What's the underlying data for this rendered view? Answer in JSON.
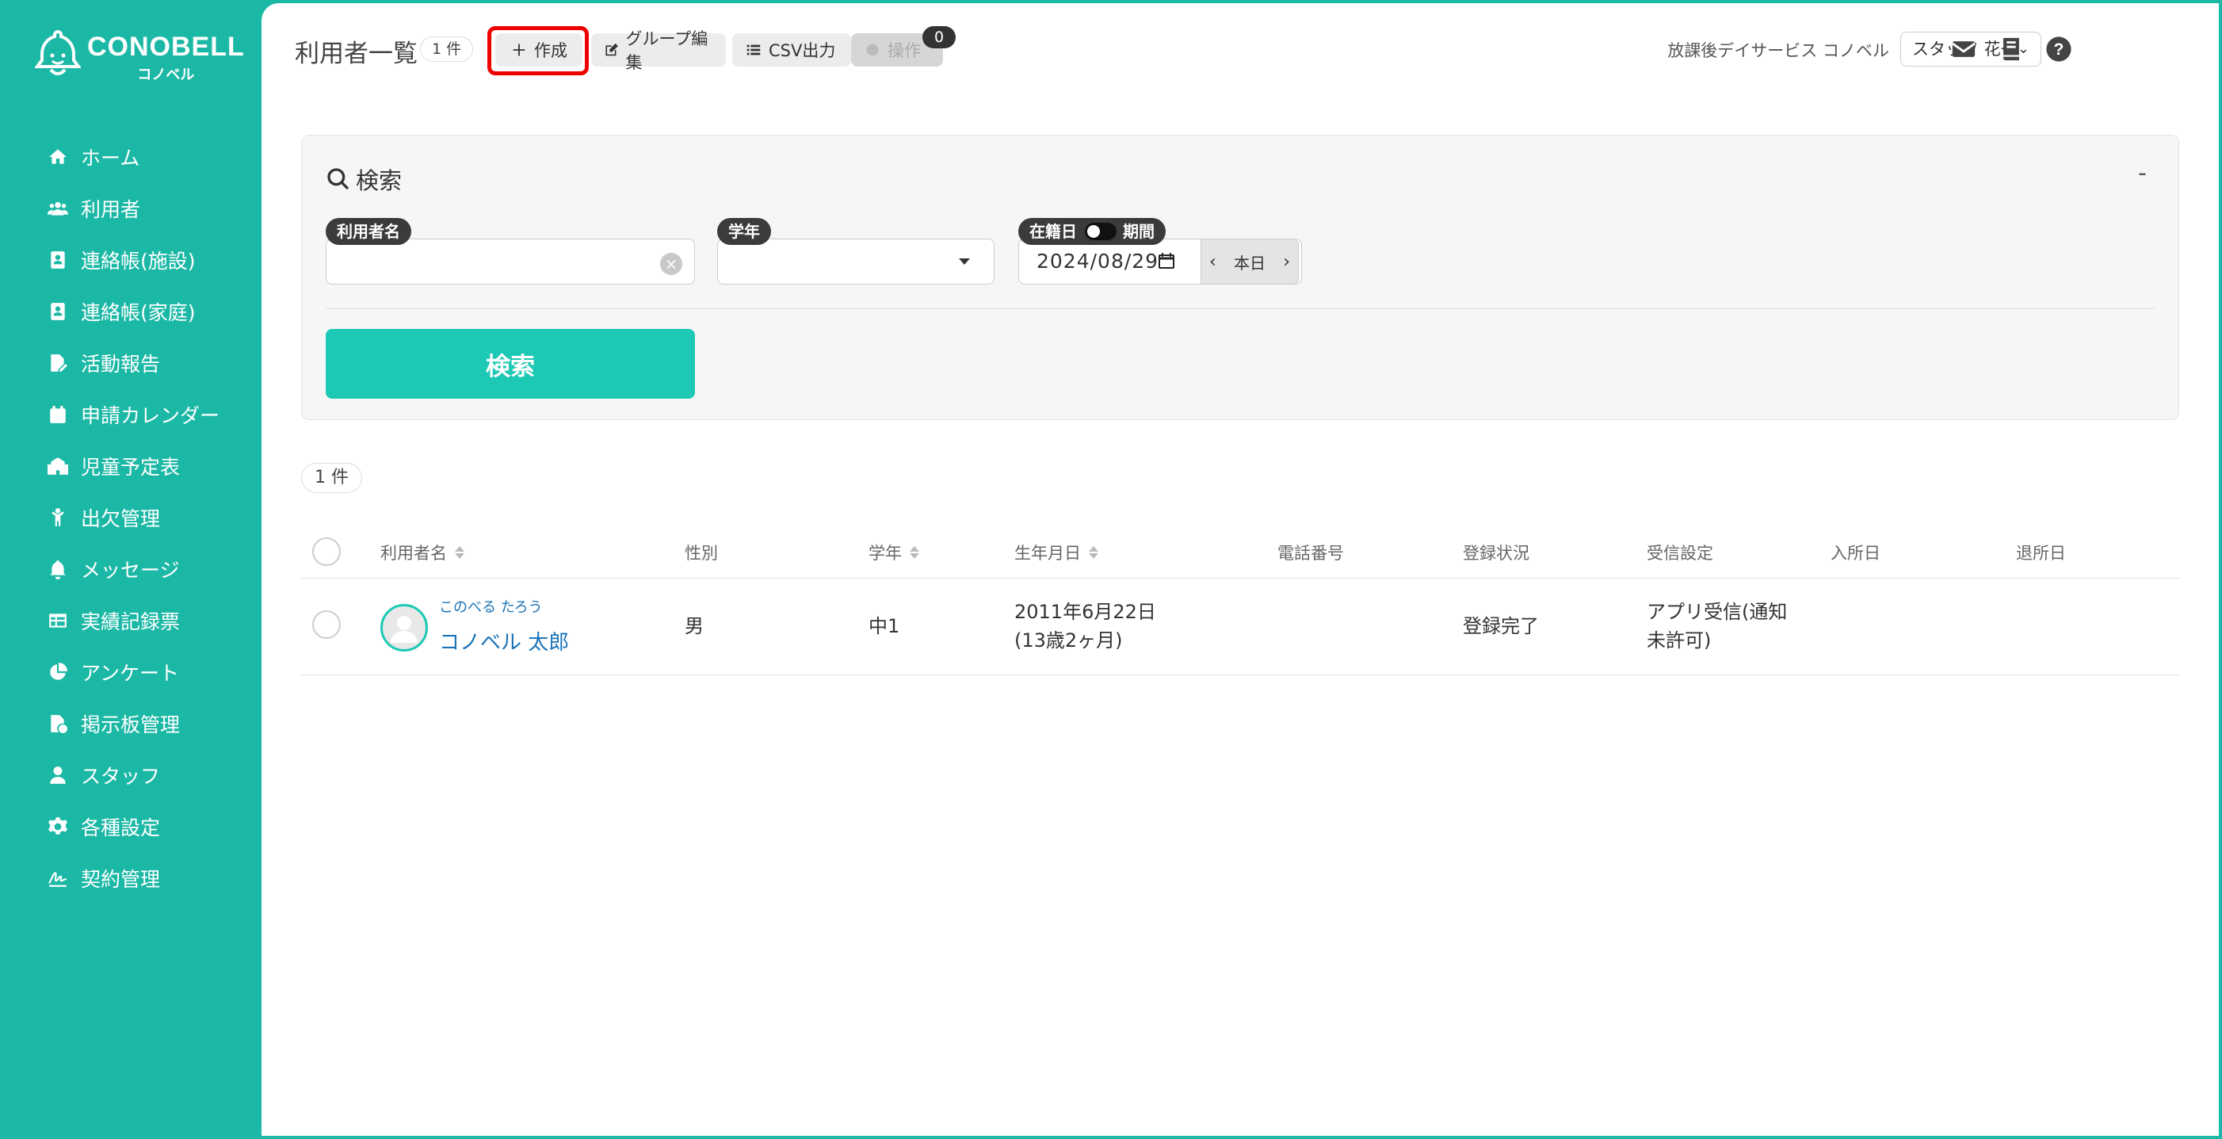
{
  "brand": {
    "name": "CONOBELL",
    "sub": "コノベル"
  },
  "sidebar": {
    "items": [
      {
        "label": "ホーム",
        "icon": "home-icon"
      },
      {
        "label": "利用者",
        "icon": "users-icon"
      },
      {
        "label": "連絡帳(施設)",
        "icon": "contact-book-icon"
      },
      {
        "label": "連絡帳(家庭)",
        "icon": "contact-book-icon"
      },
      {
        "label": "活動報告",
        "icon": "file-edit-icon"
      },
      {
        "label": "申請カレンダー",
        "icon": "calendar-icon"
      },
      {
        "label": "児童予定表",
        "icon": "school-icon"
      },
      {
        "label": "出欠管理",
        "icon": "child-icon"
      },
      {
        "label": "メッセージ",
        "icon": "bell-icon"
      },
      {
        "label": "実績記録票",
        "icon": "table-icon"
      },
      {
        "label": "アンケート",
        "icon": "pie-chart-icon"
      },
      {
        "label": "掲示板管理",
        "icon": "file-check-icon"
      },
      {
        "label": "スタッフ",
        "icon": "person-icon"
      },
      {
        "label": "各種設定",
        "icon": "gear-icon"
      },
      {
        "label": "契約管理",
        "icon": "signature-icon"
      }
    ]
  },
  "header": {
    "title": "利用者一覧",
    "count": "1 件",
    "create_label": "作成",
    "group_edit_label": "グループ編集",
    "csv_label": "CSV出力",
    "operation_label": "操作",
    "operation_badge": "0",
    "facility_name": "放課後デイサービス コノベル",
    "staff_name": "スタッフ 花子"
  },
  "search": {
    "title": "検索",
    "collapse": "-",
    "name_label": "利用者名",
    "name_value": "",
    "grade_label": "学年",
    "date_label_left": "在籍日",
    "date_label_right": "期間",
    "date_value": "2024/08/29",
    "today_label": "本日",
    "button_label": "検索"
  },
  "results": {
    "count": "1 件",
    "columns": [
      "利用者名",
      "性別",
      "学年",
      "生年月日",
      "電話番号",
      "登録状況",
      "受信設定",
      "入所日",
      "退所日"
    ],
    "rows": [
      {
        "kana": "このべる たろう",
        "name": "コノベル 太郎",
        "gender": "男",
        "grade": "中1",
        "birth_date": "2011年6月22日",
        "age": "(13歳2ヶ月)",
        "phone": "",
        "status": "登録完了",
        "receive_line1": "アプリ受信(通知",
        "receive_line2": "未許可)",
        "admission": "",
        "leave": ""
      }
    ]
  },
  "colors": {
    "accent": "#1cb8a6",
    "button": "#1dc9b4",
    "highlight": "#ee0000"
  }
}
